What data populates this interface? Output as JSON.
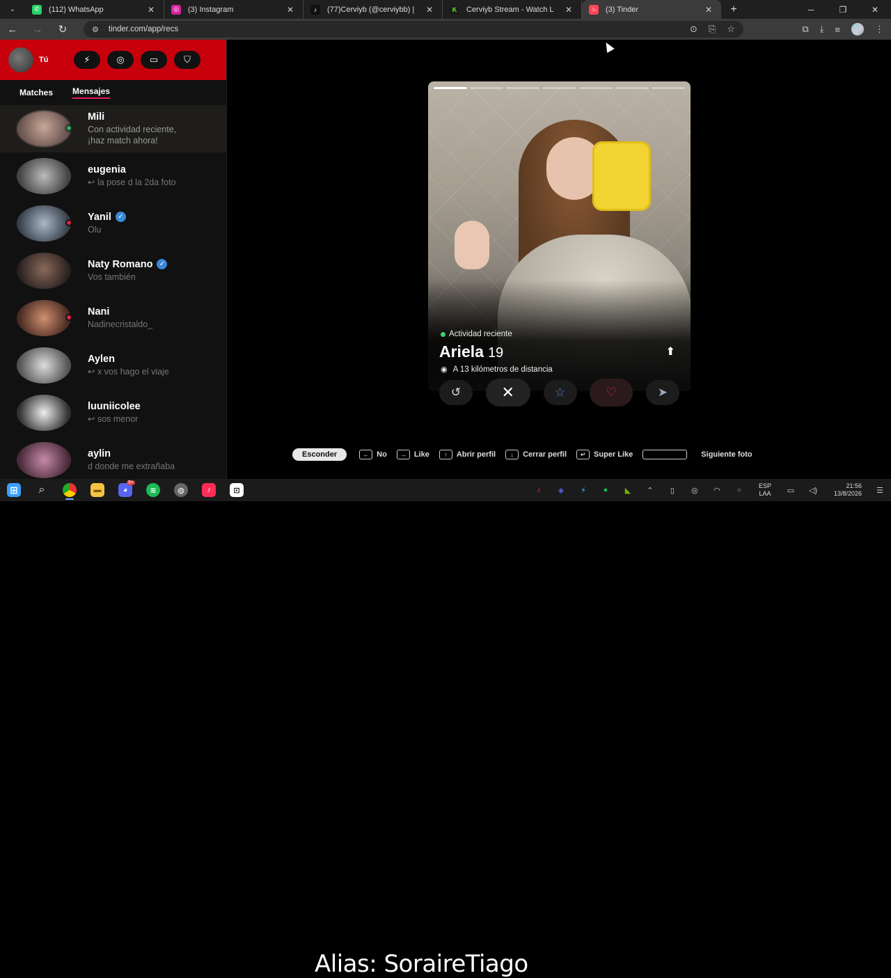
{
  "browser": {
    "tabs": [
      {
        "label": "(112) WhatsApp",
        "icon": "whatsapp-icon",
        "color": "#25d366",
        "glyph": "✆"
      },
      {
        "label": "(3) Instagram",
        "icon": "instagram-icon",
        "color": "#d6249f",
        "glyph": "◎"
      },
      {
        "label": "(77)Cerviyb (@cerviybb) |",
        "icon": "tiktok-icon",
        "color": "#111111",
        "glyph": "♪"
      },
      {
        "label": "Cerviyb Stream - Watch L",
        "icon": "kick-icon",
        "color": "#1a1a1a",
        "glyph": "K"
      },
      {
        "label": "(3) Tinder",
        "icon": "tinder-icon",
        "color": "#ff4458",
        "glyph": "♨"
      }
    ],
    "url": "tinder.com/app/recs"
  },
  "sidebar": {
    "me_label": "Tú",
    "tabs": [
      "Matches",
      "Mensajes"
    ],
    "conversations": [
      {
        "name": "Mili",
        "message": "Con actividad reciente,\n¡haz match ahora!",
        "verified": false,
        "status": "online"
      },
      {
        "name": "eugenia",
        "message": "↩ la pose d la 2da foto",
        "verified": false,
        "status": ""
      },
      {
        "name": "Yanil",
        "message": "Olu",
        "verified": true,
        "status": "unread"
      },
      {
        "name": "Naty Romano",
        "message": "Vos también",
        "verified": true,
        "status": ""
      },
      {
        "name": "Nani",
        "message": "Nadinecristaldo_",
        "verified": false,
        "status": "unread"
      },
      {
        "name": "Aylen",
        "message": "↩ x vos hago el viaje",
        "verified": false,
        "status": ""
      },
      {
        "name": "luuniicolee",
        "message": "↩ sos menor",
        "verified": false,
        "status": ""
      },
      {
        "name": "aylin",
        "message": "d donde me extrañaba",
        "verified": false,
        "status": ""
      }
    ]
  },
  "profile": {
    "activity": "Actividad reciente",
    "name": "Ariela",
    "age": "19",
    "distance": "A 13 kilómetros de distancia",
    "photo_count": 7,
    "current_photo": 1
  },
  "shortcuts": {
    "hide_label": "Esconder",
    "items": [
      {
        "key": "←",
        "label": "No"
      },
      {
        "key": "→",
        "label": "Like"
      },
      {
        "key": "↑",
        "label": "Abrir perfil"
      },
      {
        "key": "↓",
        "label": "Cerrar perfil"
      },
      {
        "key": "↵",
        "label": "Super Like"
      },
      {
        "key": "",
        "label": "Siguiente foto",
        "wide": true
      }
    ]
  },
  "taskbar": {
    "alias": "Alias: SoraireTiago",
    "lang_top": "ESP",
    "lang_bottom": "LAA",
    "time": "21:56",
    "date": "13/8/2026",
    "discord_badge": "9+"
  },
  "colors": {
    "tinder_red": "#c8000c",
    "accent_pink": "#e8195b",
    "online": "#3ecf6e",
    "unread": "#e0223f",
    "verified": "#3b88d8"
  }
}
